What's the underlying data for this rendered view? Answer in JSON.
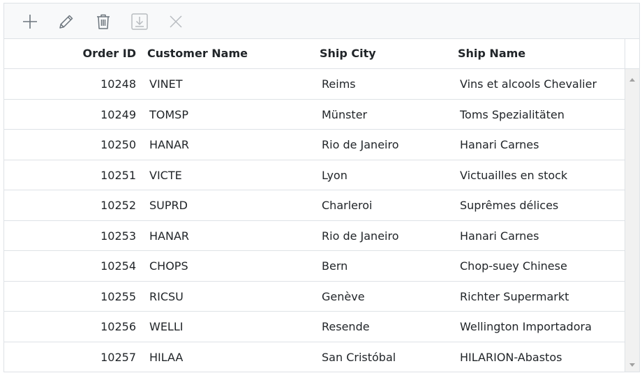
{
  "toolbar": {
    "buttons": [
      {
        "name": "add-button",
        "icon": "plus-icon",
        "enabled": true
      },
      {
        "name": "edit-button",
        "icon": "pencil-icon",
        "enabled": true
      },
      {
        "name": "delete-button",
        "icon": "trash-icon",
        "enabled": true
      },
      {
        "name": "update-button",
        "icon": "save-icon",
        "enabled": false
      },
      {
        "name": "cancel-button",
        "icon": "close-icon",
        "enabled": false
      }
    ]
  },
  "columns": {
    "order_id": "Order ID",
    "customer_name": "Customer Name",
    "ship_city": "Ship City",
    "ship_name": "Ship Name"
  },
  "rows": [
    {
      "order_id": "10248",
      "customer": "VINET",
      "city": "Reims",
      "ship": "Vins et alcools Chevalier"
    },
    {
      "order_id": "10249",
      "customer": "TOMSP",
      "city": "Münster",
      "ship": "Toms Spezialitäten"
    },
    {
      "order_id": "10250",
      "customer": "HANAR",
      "city": "Rio de Janeiro",
      "ship": "Hanari Carnes"
    },
    {
      "order_id": "10251",
      "customer": "VICTE",
      "city": "Lyon",
      "ship": "Victuailles en stock"
    },
    {
      "order_id": "10252",
      "customer": "SUPRD",
      "city": "Charleroi",
      "ship": "Suprêmes délices"
    },
    {
      "order_id": "10253",
      "customer": "HANAR",
      "city": "Rio de Janeiro",
      "ship": "Hanari Carnes"
    },
    {
      "order_id": "10254",
      "customer": "CHOPS",
      "city": "Bern",
      "ship": "Chop-suey Chinese"
    },
    {
      "order_id": "10255",
      "customer": "RICSU",
      "city": "Genève",
      "ship": "Richter Supermarkt"
    },
    {
      "order_id": "10256",
      "customer": "WELLI",
      "city": "Resende",
      "ship": "Wellington Importadora"
    },
    {
      "order_id": "10257",
      "customer": "HILAA",
      "city": "San Cristóbal",
      "ship": "HILARION-Abastos"
    }
  ],
  "colors": {
    "border": "#dee2e6",
    "toolbar_bg": "#f8f9fa",
    "icon_enabled": "#6c757d",
    "icon_disabled": "#b8bcc0",
    "text": "#212529"
  }
}
